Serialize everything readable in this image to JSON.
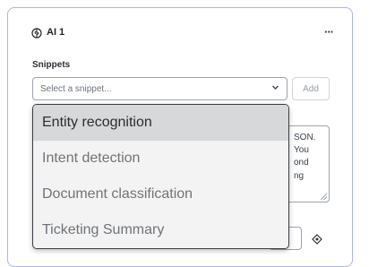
{
  "card": {
    "title": "AI 1",
    "icon": "brain-icon",
    "menu_icon": "more-horizontal-icon"
  },
  "snippets": {
    "label": "Snippets",
    "placeholder": "Select a snippet...",
    "add_label": "Add"
  },
  "dropdown": {
    "options": [
      {
        "label": "Entity recognition",
        "highlighted": true
      },
      {
        "label": "Intent detection",
        "highlighted": false
      },
      {
        "label": "Document classification",
        "highlighted": false
      },
      {
        "label": "Ticketing Summary",
        "highlighted": false
      }
    ]
  },
  "textarea": {
    "visible_fragments": [
      "SON.",
      "You",
      "ond",
      "ng"
    ]
  },
  "colors": {
    "card_border": "#aeb4e6",
    "highlight": "#d7d8da",
    "dropdown_bg": "#f3f3f3"
  }
}
